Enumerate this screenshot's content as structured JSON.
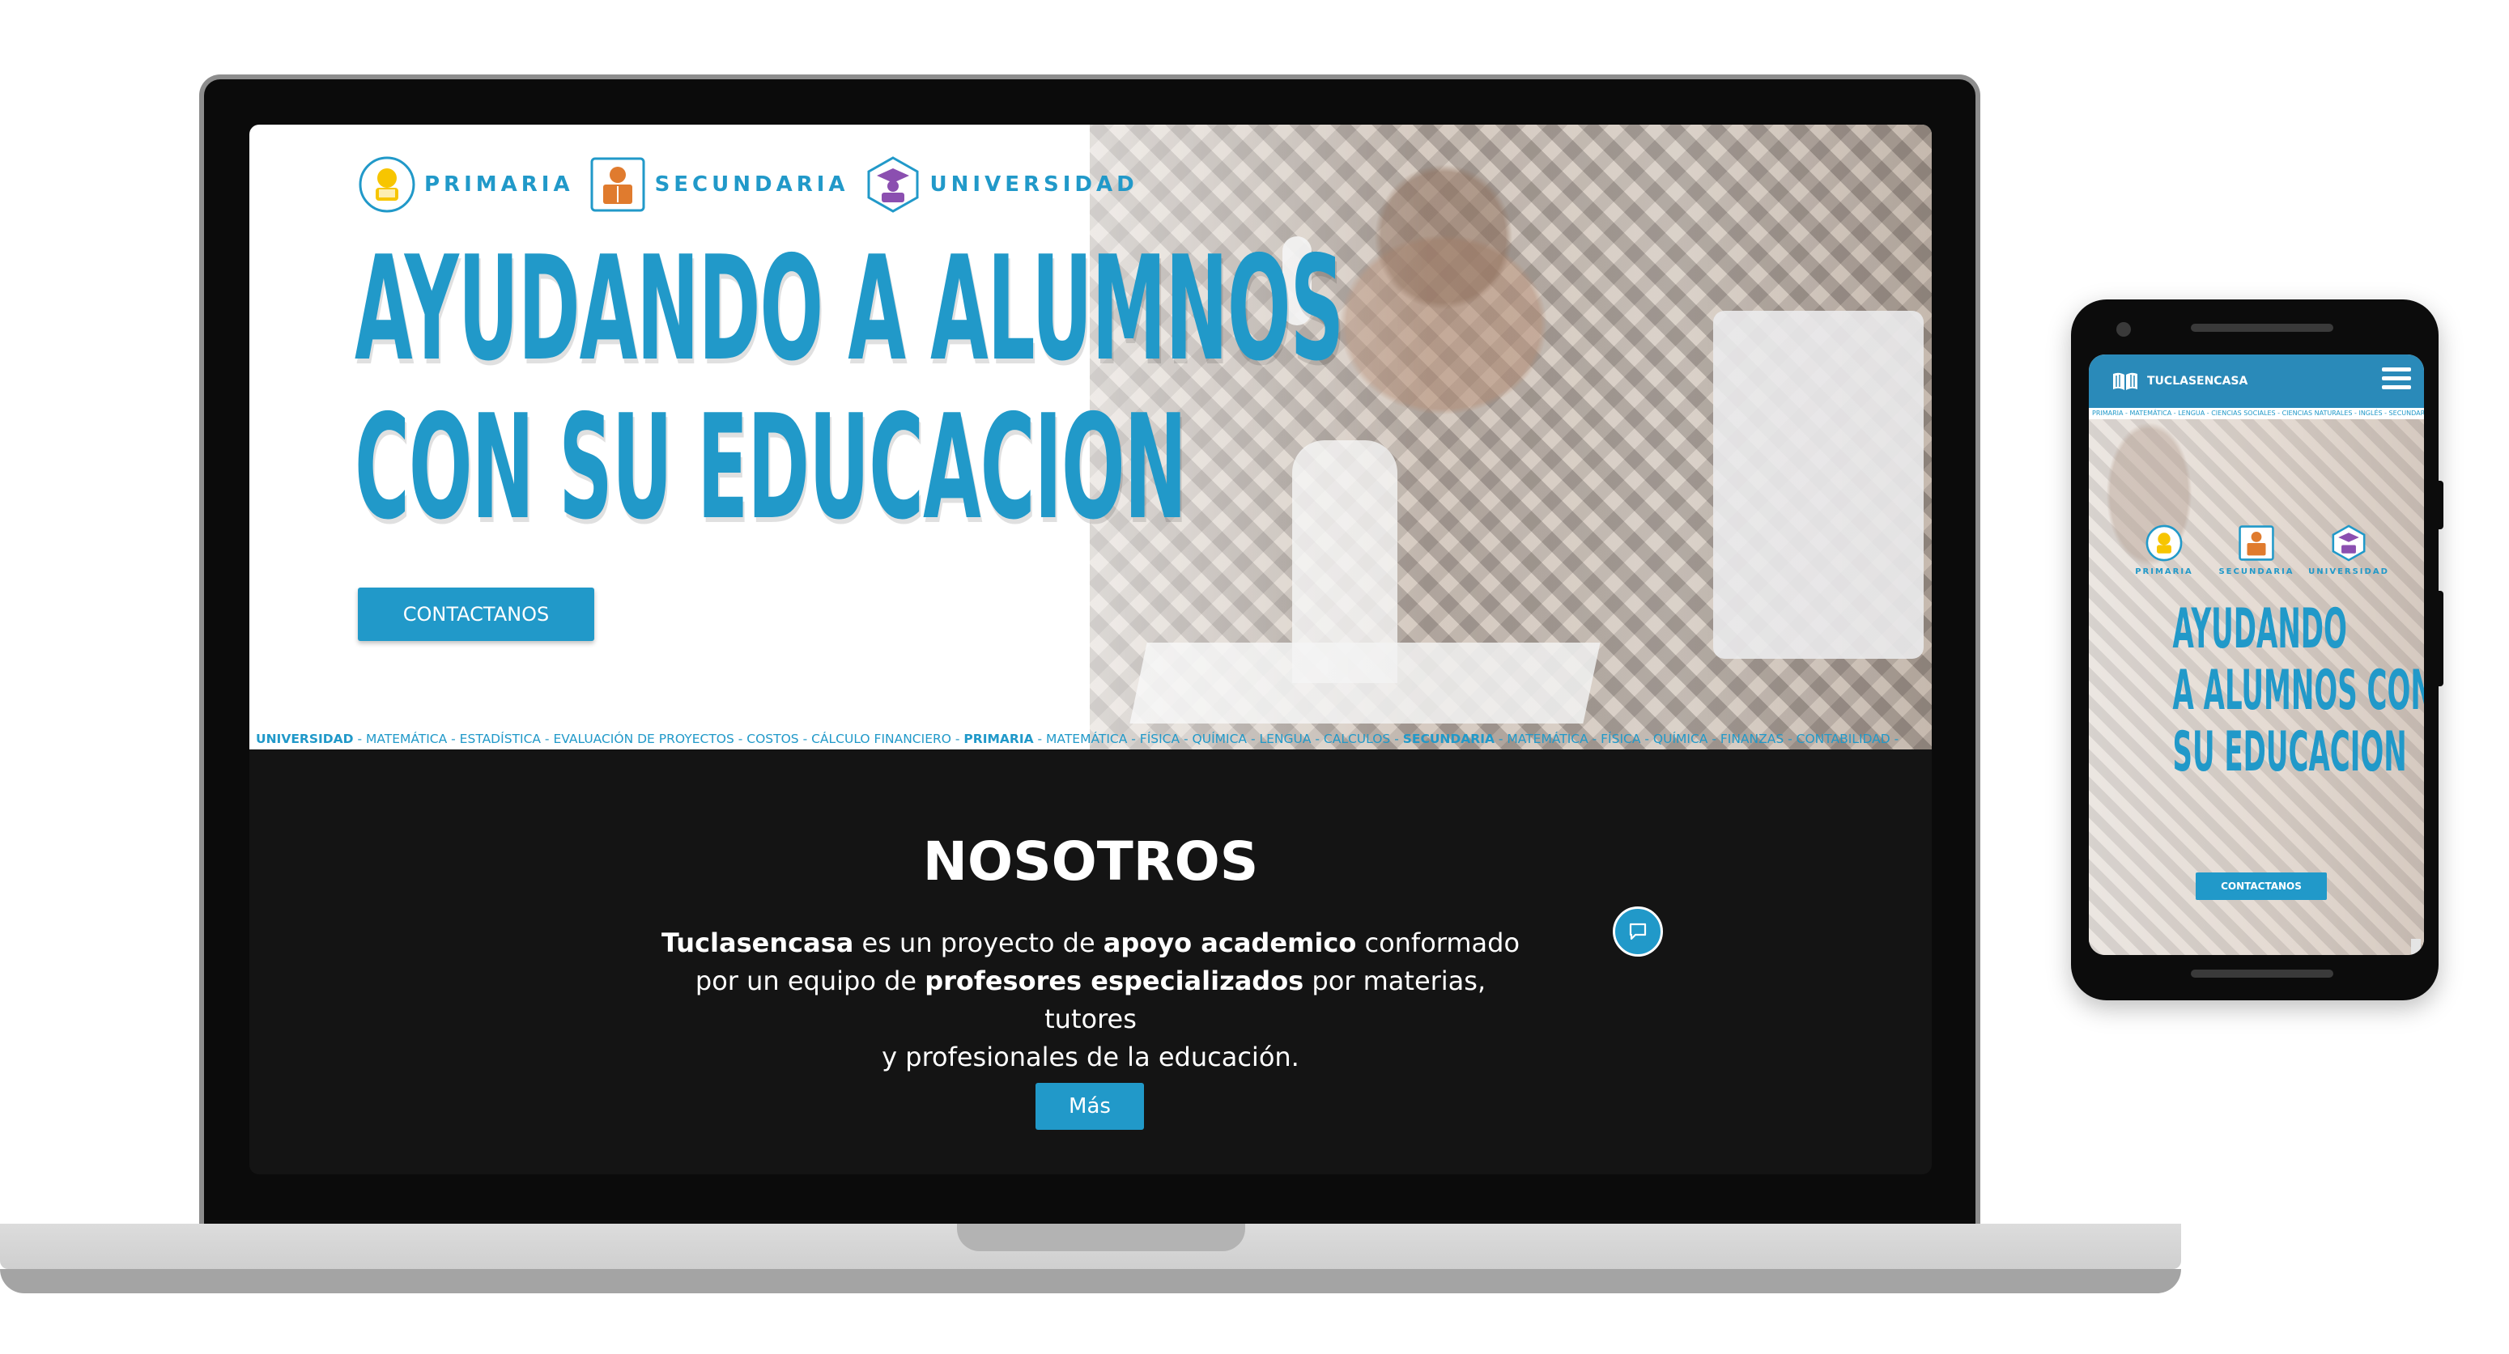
{
  "colors": {
    "accent": "#2199c9",
    "dark": "#141414",
    "white": "#ffffff"
  },
  "desktop": {
    "levels": [
      {
        "label": "PRIMARIA",
        "icon": "child-reading-icon",
        "color": "#f7c500"
      },
      {
        "label": "SECUNDARIA",
        "icon": "student-book-icon",
        "color": "#e07b2e"
      },
      {
        "label": "UNIVERSIDAD",
        "icon": "graduation-cap-icon",
        "color": "#8b4fb0"
      }
    ],
    "hero": {
      "title_line1": "AYUDANDO A ALUMNOS",
      "title_line2": "CON SU EDUCACION",
      "cta_label": "CONTACTANOS"
    },
    "ticker": [
      {
        "text": "UNIVERSIDAD",
        "bold": true
      },
      {
        "text": " - MATEMÁTICA - ESTADÍSTICA - EVALUACIÓN DE PROYECTOS - COSTOS - CÁLCULO FINANCIERO - ",
        "bold": false
      },
      {
        "text": "PRIMARIA",
        "bold": true
      },
      {
        "text": " - MATEMÁTICA - FÍSICA - QUÍMICA - LENGUA - CALCULOS - ",
        "bold": false
      },
      {
        "text": "SECUNDARIA",
        "bold": true
      },
      {
        "text": " - MATEMÁTICA - FÍSICA - QUÍMICA - FINANZAS - CONTABILIDAD -",
        "bold": false
      }
    ],
    "about": {
      "title": "NOSOTROS",
      "p1_bold": "Tuclasencasa",
      "p1_text": " es un proyecto de ",
      "p2_bold": "apoyo academico",
      "p2_text": " conformado",
      "p3_text": "por un equipo de ",
      "p4_bold": "profesores especializados",
      "p4_text": " por materias, tutores",
      "p5_text": "y profesionales de la educación.",
      "more_label": "Más"
    },
    "chat_icon": "chat-icon"
  },
  "mobile": {
    "brand": "TUCLASENCASA",
    "ticker_text": "PRIMARIA - MATEMÁTICA - LENGUA - CIENCIAS SOCIALES - CIENCIAS NATURALES - INGLÉS - SECUNDARIA - M",
    "levels": [
      "PRIMARIA",
      "SECUNDARIA",
      "UNIVERSIDAD"
    ],
    "title_line1": "AYUDANDO",
    "title_line2": "A ALUMNOS CON",
    "title_line3": "SU EDUCACION",
    "cta_label": "CONTACTANOS"
  }
}
